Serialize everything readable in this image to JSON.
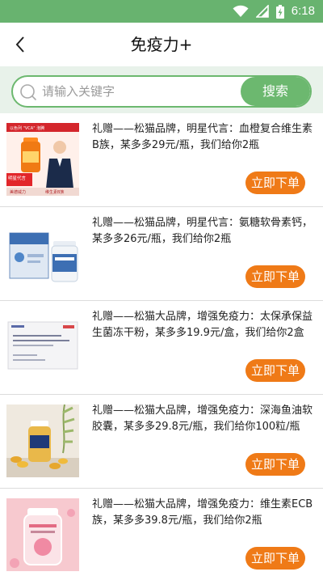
{
  "status_bar": {
    "time": "6:18",
    "icons": [
      "wifi-icon",
      "signal-icon",
      "battery-charging-icon"
    ]
  },
  "nav": {
    "title": "免疫力+",
    "back_icon": "chevron-left-icon"
  },
  "search": {
    "placeholder": "请输入关键字",
    "button_label": "搜索",
    "icon": "search-icon"
  },
  "colors": {
    "brand_green": "#68b36f",
    "button_orange": "#ef7a17",
    "background": "#e8f2ea"
  },
  "products": [
    {
      "description": "礼赠——松猫品牌，明星代言：血橙复合维生素B族，某多多29元/瓶，我们给你2瓶",
      "button_label": "立即下单",
      "image_text": [
        "以色列 \"VCA\" 泡腾",
        "明星代言",
        "美德威力",
        "维生素B族"
      ]
    },
    {
      "description": "礼赠——松猫品牌，明星代言：氨糖软骨素钙，某多多26元/瓶，我们给你2瓶",
      "button_label": "立即下单"
    },
    {
      "description": "礼赠——松猫大品牌，增强免疫力：太保承保益生菌冻干粉，某多多19.9元/盒，我们给你2盒",
      "button_label": "立即下单"
    },
    {
      "description": "礼赠——松猫大品牌，增强免疫力：深海鱼油软胶囊，某多多29.8元/瓶，我们给你100粒/瓶",
      "button_label": "立即下单"
    },
    {
      "description": "礼赠——松猫大品牌，增强免疫力：维生素ECB族，某多多39.8元/瓶，我们给你2瓶",
      "button_label": "立即下单"
    }
  ]
}
